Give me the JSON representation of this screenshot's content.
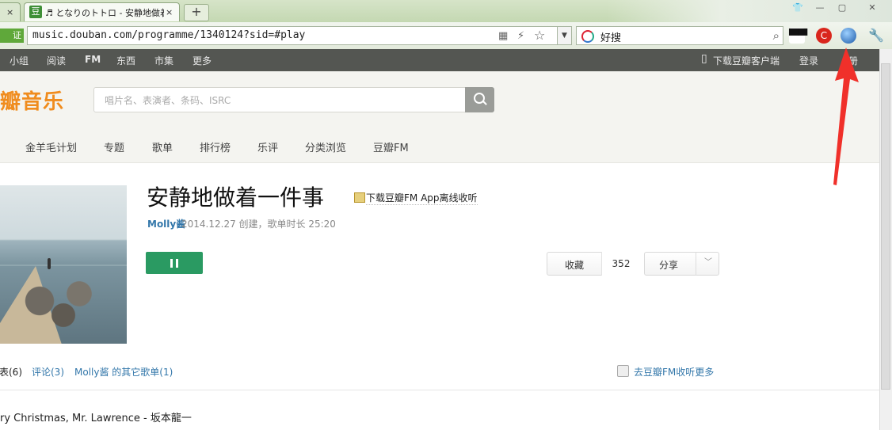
{
  "browser": {
    "tabs": [
      {
        "title": "",
        "close": "×"
      },
      {
        "favicon": "豆",
        "title": "♬ となりのトトロ - 安静地做着一件事",
        "close": "×"
      }
    ],
    "new_tab": "+",
    "window_buttons": [
      "—",
      "▢",
      "✕"
    ],
    "cert_label": "证",
    "url": "music.douban.com/programme/1340124?sid=#play",
    "search_engine_label": "好搜",
    "icons": [
      "qrcode-icon",
      "lightning-icon",
      "star-icon",
      "dropdown-icon",
      "search-icon",
      "adblock-icon",
      "translate-icon",
      "globe-icon",
      "wrench-icon"
    ]
  },
  "site_nav": {
    "items": [
      "小组",
      "阅读",
      "FM",
      "东西",
      "市集",
      "更多"
    ],
    "download_app": "下载豆瓣客户端",
    "login": "登录",
    "register": "册"
  },
  "header": {
    "logo": "瓣音乐",
    "search_placeholder": "唱片名、表演者、条码、ISRC"
  },
  "sub_nav": {
    "items": [
      "金羊毛计划",
      "专题",
      "歌单",
      "排行榜",
      "乐评",
      "分类浏览",
      "豆瓣FM"
    ]
  },
  "programme": {
    "title": "安静地做着一件事",
    "download_fm": "下载豆瓣FM App离线收听",
    "creator": "Molly酱",
    "meta": "2014.12.27 创建，歌单时长 25:20",
    "collect_label": "收藏",
    "collect_count": "352",
    "share_label": "分享"
  },
  "content_tabs": {
    "list": "表(6)",
    "comments": "评论(3)",
    "other_lists": "Molly酱 的其它歌单(1)",
    "fm_more": "去豆瓣FM收听更多"
  },
  "tracks": [
    "ry Christmas, Mr. Lawrence - 坂本龍一"
  ],
  "colors": {
    "accent_orange": "#f08c1e",
    "play_green": "#2a9a62",
    "link_blue": "#3377aa",
    "nav_dark": "#545652",
    "annotation_red": "#f0302a"
  }
}
